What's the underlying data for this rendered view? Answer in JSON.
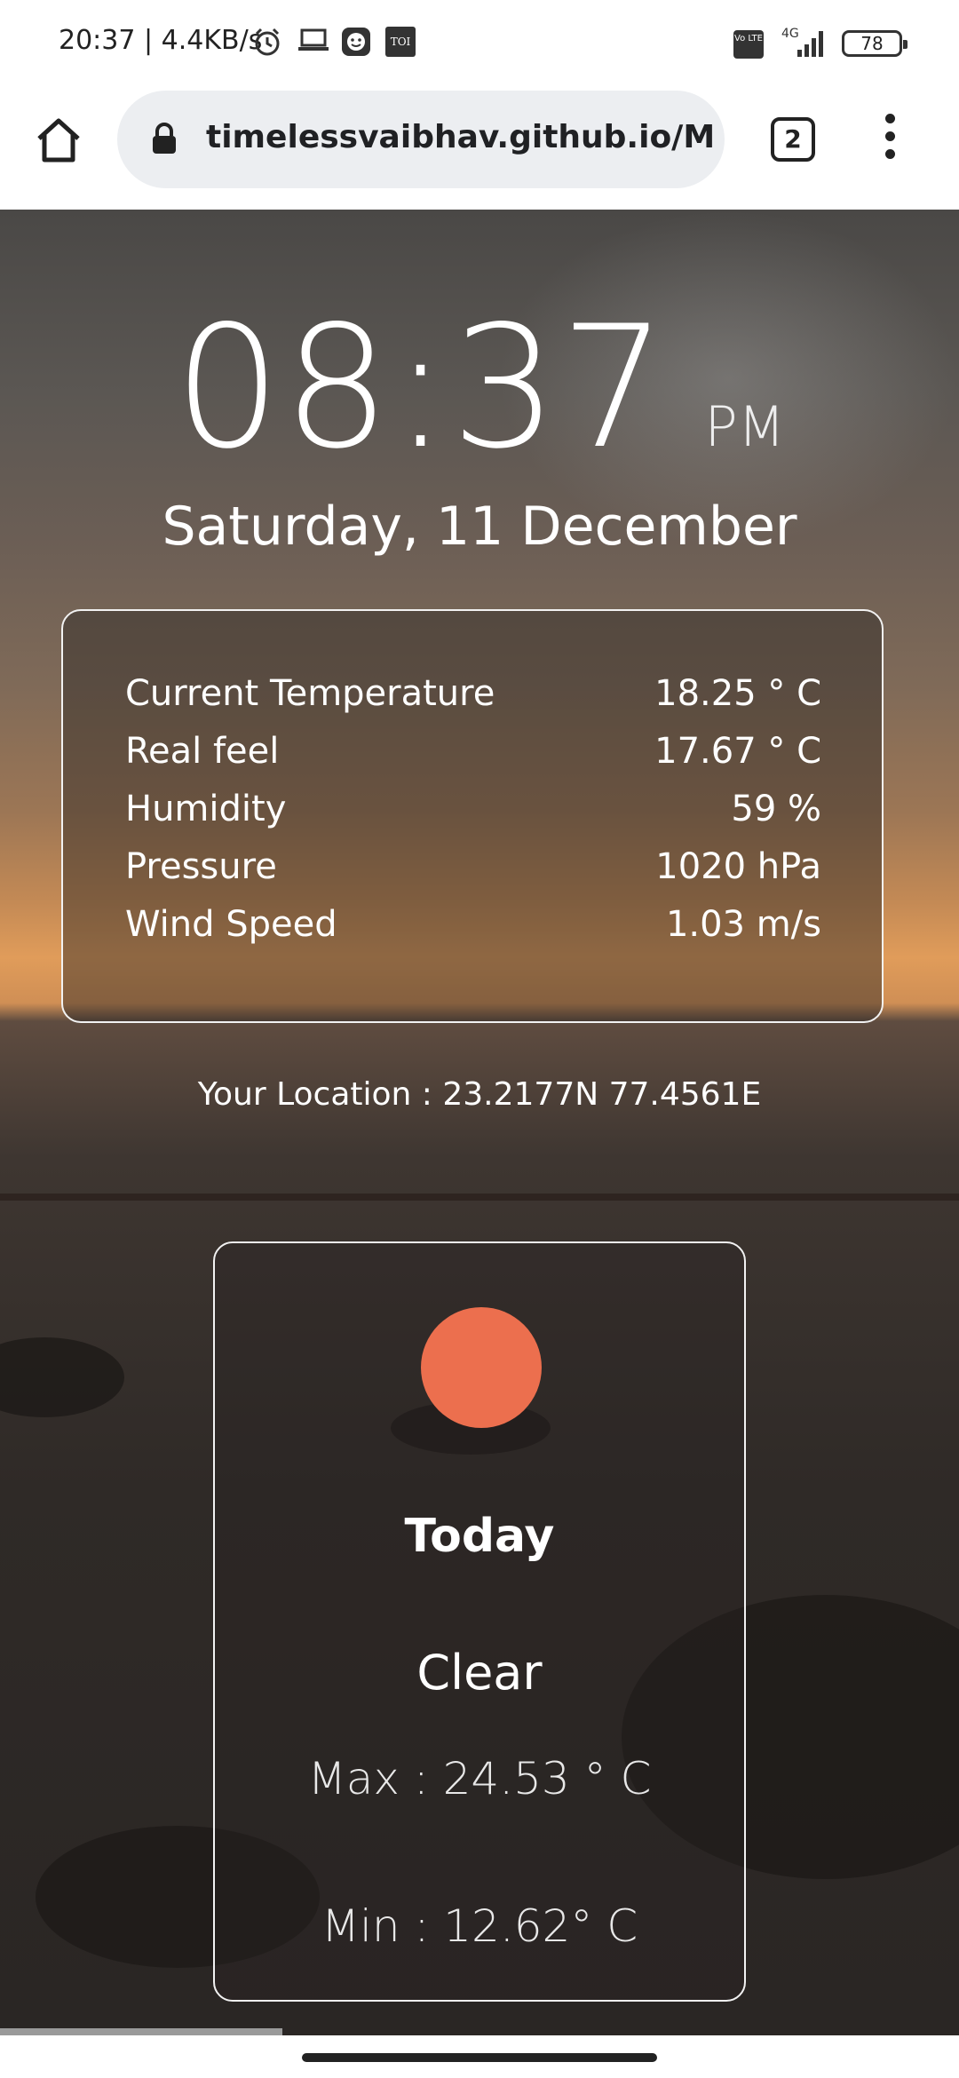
{
  "status_bar": {
    "time_speed": "20:37 | 4.4KB/s",
    "network": "4G",
    "volte": "Vo LTE",
    "battery": "78",
    "notification_app": "TOI"
  },
  "browser": {
    "url": "timelessvaibhav.github.io/My",
    "tab_count": "2"
  },
  "clock": {
    "time": "08:37",
    "ampm": "PM",
    "date": "Saturday, 11 December"
  },
  "weather": {
    "rows": [
      {
        "label": "Current Temperature",
        "value": "18.25 ° C"
      },
      {
        "label": "Real feel",
        "value": "17.67 ° C"
      },
      {
        "label": "Humidity",
        "value": "59 %"
      },
      {
        "label": "Pressure",
        "value": "1020 hPa"
      },
      {
        "label": "Wind Speed",
        "value": "1.03 m/s"
      }
    ]
  },
  "location": "Your Location : 23.2177N 77.4561E",
  "today": {
    "title": "Today",
    "condition": "Clear",
    "max": "Max : 24.53 ° C",
    "min": "Min : 12.62° C",
    "icon_color": "#ec6f4e"
  }
}
